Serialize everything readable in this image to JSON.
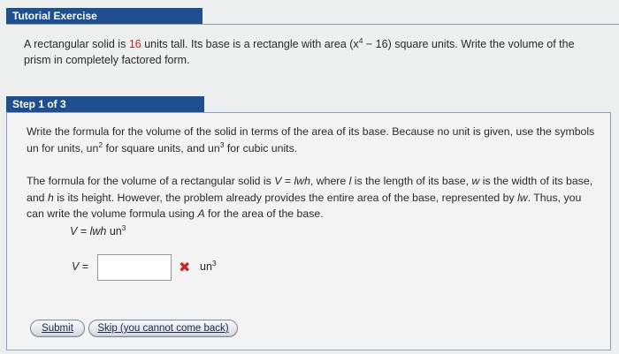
{
  "tutorial": {
    "title": "Tutorial Exercise"
  },
  "problem": {
    "part1": "A rectangular solid is ",
    "height": "16",
    "part2": " units tall. Its base is a rectangle with area ",
    "area_open": "(x",
    "area_exp": "4",
    "area_close": " − 16)",
    "part3": " square units. Write the volume of the prism in completely factored form."
  },
  "step": {
    "title": "Step 1 of 3",
    "para1": {
      "text_a": "Write the formula for the volume of the solid in terms of the area of its base. Because no unit is given, use the symbols un for units, un",
      "exp_a": "2",
      "text_b": " for square units, and un",
      "exp_b": "3",
      "text_c": " for cubic units."
    },
    "para2": {
      "t1": "The formula for the volume of a rectangular solid is ",
      "v": "V",
      "eq": " = ",
      "lwh": "lwh",
      "t2": ",  where ",
      "l": "l",
      "t3": " is the length of its base, ",
      "w": "w",
      "t4": " is the width of its base, and ",
      "h": "h",
      "t5": " is its height. However, the problem already provides the entire area of the base, represented by ",
      "lw": "lw",
      "t6": ". Thus, you can write the volume formula using ",
      "a": "A",
      "t7": " for the area of the base."
    },
    "formula": {
      "v": "V",
      "eq": " = ",
      "lwh": "lwh",
      "unit": " un",
      "exp": "3"
    },
    "answer": {
      "label_v": "V",
      "label_eq": " =",
      "value": "",
      "unit": "un",
      "unit_exp": "3"
    },
    "buttons": {
      "submit": "Submit",
      "skip": "Skip (you cannot come back)"
    }
  },
  "colors": {
    "header_bg": "#1d4f91",
    "highlight": "#c62828",
    "error_icon": "#c62828"
  }
}
